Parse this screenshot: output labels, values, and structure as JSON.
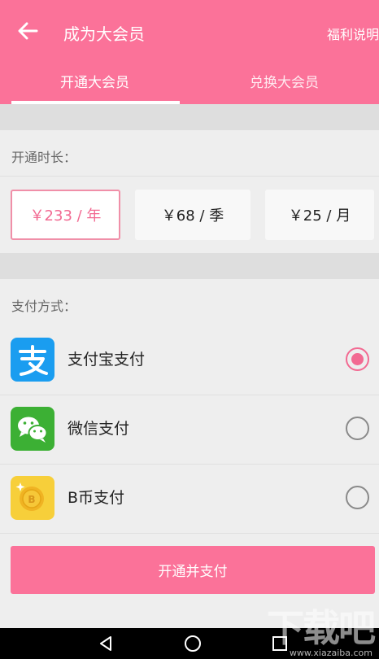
{
  "header": {
    "title": "成为大会员",
    "welfare_link": "福利说明",
    "tabs": [
      {
        "label": "开通大会员",
        "active": true
      },
      {
        "label": "兑换大会员",
        "active": false
      }
    ]
  },
  "duration": {
    "label": "开通时长：",
    "options": [
      {
        "label": "￥233 / 年",
        "selected": true
      },
      {
        "label": "￥68 / 季",
        "selected": false
      },
      {
        "label": "￥25 / 月",
        "selected": false
      }
    ]
  },
  "payment": {
    "label": "支付方式：",
    "methods": [
      {
        "label": "支付宝支付",
        "icon": "alipay-icon",
        "selected": true
      },
      {
        "label": "微信支付",
        "icon": "wechat-icon",
        "selected": false
      },
      {
        "label": "B币支付",
        "icon": "bcoin-icon",
        "selected": false
      }
    ]
  },
  "submit_label": "开通并支付",
  "watermark": {
    "text": "下载吧",
    "url": "www.xiazaiba.com"
  },
  "colors": {
    "accent": "#fb7299",
    "selected_text": "#f26a92",
    "alipay": "#1a9df0",
    "wechat": "#3cb034",
    "bcoin": "#f5c22b"
  }
}
